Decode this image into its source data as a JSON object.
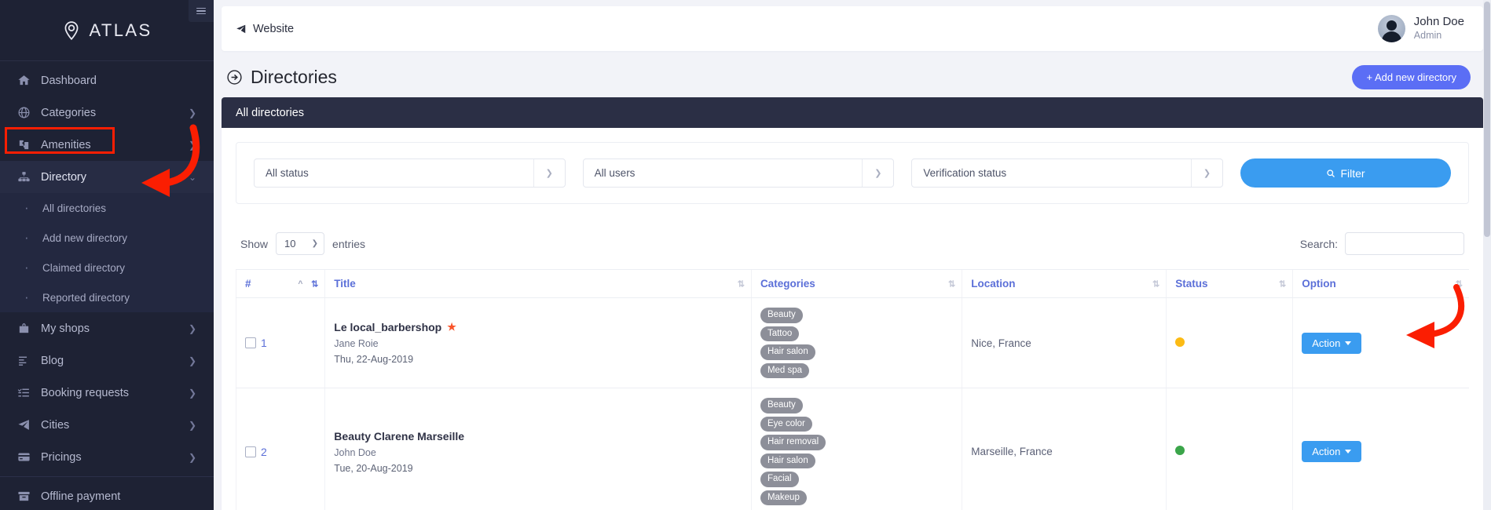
{
  "brand": {
    "name": "ATLAS",
    "logo_icon": "map-pin-icon"
  },
  "sidebar": {
    "collapse_icon": "hamburger-icon",
    "items": [
      {
        "label": "Dashboard",
        "icon": "home-icon",
        "has_chevron": false,
        "active": false
      },
      {
        "label": "Categories",
        "icon": "globe-icon",
        "has_chevron": true,
        "active": false
      },
      {
        "label": "Amenities",
        "icon": "puzzle-icon",
        "has_chevron": true,
        "active": false
      },
      {
        "label": "Directory",
        "icon": "sitemap-icon",
        "has_chevron": true,
        "active": true
      },
      {
        "label": "My shops",
        "icon": "bag-icon",
        "has_chevron": true,
        "active": false
      },
      {
        "label": "Blog",
        "icon": "lines-icon",
        "has_chevron": true,
        "active": false
      },
      {
        "label": "Booking requests",
        "icon": "checklist-icon",
        "has_chevron": true,
        "active": false
      },
      {
        "label": "Cities",
        "icon": "paper-plane-icon",
        "has_chevron": true,
        "active": false
      },
      {
        "label": "Pricings",
        "icon": "credit-card-icon",
        "has_chevron": true,
        "active": false
      },
      {
        "label": "Offline payment",
        "icon": "archive-icon",
        "has_chevron": false,
        "active": false
      }
    ],
    "directory_subitems": [
      {
        "label": "All directories"
      },
      {
        "label": "Add new directory"
      },
      {
        "label": "Claimed directory"
      },
      {
        "label": "Reported directory"
      }
    ]
  },
  "topbar": {
    "website_label": "Website",
    "website_icon": "paper-plane-icon",
    "user_name": "John Doe",
    "user_role": "Admin",
    "avatar_icon": "user-avatar"
  },
  "page": {
    "title": "Directories",
    "title_icon": "arrow-circle-right-icon",
    "add_button_label": "+ Add new directory"
  },
  "card": {
    "header_title": "All directories"
  },
  "filters": {
    "status": {
      "value": "All status",
      "caret_icon": "chevron-down-icon"
    },
    "users": {
      "value": "All users",
      "caret_icon": "chevron-down-icon"
    },
    "verification": {
      "value": "Verification status",
      "caret_icon": "chevron-down-icon"
    },
    "filter_button_label": "Filter",
    "filter_button_icon": "search-icon"
  },
  "table_tools": {
    "show_label": "Show",
    "entries_label": "entries",
    "page_length": "10",
    "search_label": "Search:",
    "search_value": "",
    "search_placeholder": ""
  },
  "table": {
    "columns": [
      {
        "label": "#",
        "sort_icon": "sort-desc-icon"
      },
      {
        "label": "Title",
        "sort_icon": "sort-icon"
      },
      {
        "label": "Categories",
        "sort_icon": "sort-icon"
      },
      {
        "label": "Location",
        "sort_icon": "sort-icon"
      },
      {
        "label": "Status",
        "sort_icon": "sort-icon"
      },
      {
        "label": "Option",
        "sort_icon": "sort-icon"
      }
    ],
    "rows": [
      {
        "index": "1",
        "title": "Le local_barbershop",
        "featured": true,
        "owner": "Jane Roie",
        "date": "Thu, 22-Aug-2019",
        "categories": [
          "Beauty",
          "Tattoo",
          "Hair salon",
          "Med spa"
        ],
        "location": "Nice, France",
        "status_color": "#fcbb14",
        "action_label": "Action"
      },
      {
        "index": "2",
        "title": "Beauty Clarene Marseille",
        "featured": false,
        "owner": "John Doe",
        "date": "Tue, 20-Aug-2019",
        "categories": [
          "Beauty",
          "Eye color",
          "Hair removal",
          "Hair salon",
          "Facial",
          "Makeup"
        ],
        "location": "Marseille, France",
        "status_color": "#3ba54a",
        "action_label": "Action"
      }
    ]
  },
  "colors": {
    "sidebar_bg": "#1e2234",
    "accent_blue": "#3a9cf0",
    "brand_purple": "#5b6ef5",
    "card_header": "#2b2f45",
    "annotation_red": "#fb1e02"
  }
}
